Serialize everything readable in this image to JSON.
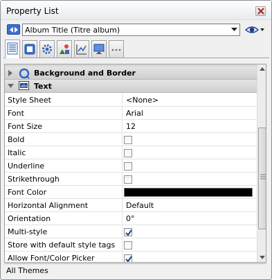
{
  "window": {
    "title": "Property List"
  },
  "object_selector": {
    "selected": "Album Title (Titre album)"
  },
  "tabs": [
    "properties-tab",
    "appearance-tab",
    "settings-tab",
    "shapes-tab",
    "chart-tab",
    "display-tab",
    "more-tab"
  ],
  "groups": {
    "background_border": "Background and Border",
    "text": "Text"
  },
  "properties": [
    {
      "name": "Style Sheet",
      "value": "<None>",
      "kind": "text"
    },
    {
      "name": "Font",
      "value": "Arial",
      "kind": "text"
    },
    {
      "name": "Font Size",
      "value": "12",
      "kind": "text"
    },
    {
      "name": "Bold",
      "checked": false,
      "kind": "checkbox"
    },
    {
      "name": "Italic",
      "checked": false,
      "kind": "checkbox"
    },
    {
      "name": "Underline",
      "checked": false,
      "kind": "checkbox"
    },
    {
      "name": "Strikethrough",
      "checked": false,
      "kind": "checkbox"
    },
    {
      "name": "Font Color",
      "color": "#000000",
      "kind": "color"
    },
    {
      "name": "Horizontal Alignment",
      "value": "Default",
      "kind": "text"
    },
    {
      "name": "Orientation",
      "value": "0°",
      "kind": "text"
    },
    {
      "name": "Multi-style",
      "checked": true,
      "kind": "checkbox"
    },
    {
      "name": "Store with default style tags",
      "checked": false,
      "kind": "checkbox"
    },
    {
      "name": "Allow Font/Color Picker",
      "checked": true,
      "kind": "checkbox"
    }
  ],
  "status": {
    "text": "All Themes"
  },
  "colors": {
    "accent": "#3a6fd1",
    "checkmark": "#1f3f8f"
  }
}
